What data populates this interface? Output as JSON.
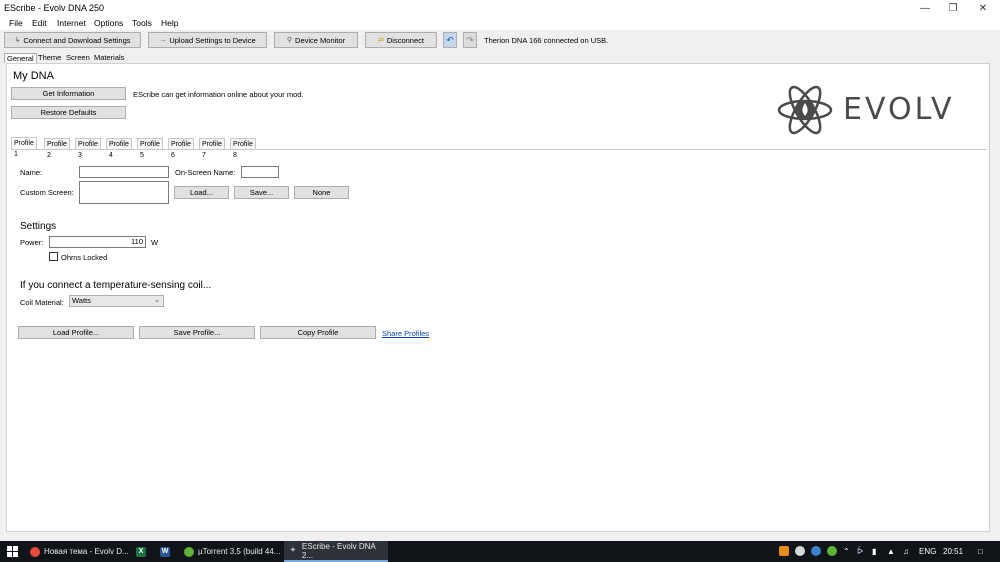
{
  "window": {
    "title": "EScribe - Evolv DNA 250",
    "controls": [
      "minimize-icon",
      "restore-icon",
      "close-icon"
    ]
  },
  "menu": [
    "File",
    "Edit",
    "Internet",
    "Options",
    "Tools",
    "Help"
  ],
  "toolbar": {
    "connect_label": "Connect and Download Settings",
    "upload_label": "Upload Settings to Device",
    "monitor_label": "Device Monitor",
    "disconnect_label": "Disconnect",
    "status_text": "Therion DNA 166 connected on USB."
  },
  "main_tabs": [
    "General",
    "Theme",
    "Screen",
    "Materials"
  ],
  "mydna": {
    "heading": "My DNA",
    "get_info_label": "Get Information",
    "restore_label": "Restore Defaults",
    "info_text": "EScribe can get information online about your mod."
  },
  "logo": {
    "text": "EVOLV",
    "color": "#4a4a4a"
  },
  "profile_tabs": [
    "Profile 1",
    "Profile 2",
    "Profile 3",
    "Profile 4",
    "Profile 5",
    "Profile 6",
    "Profile 7",
    "Profile 8"
  ],
  "profile": {
    "name_label": "Name:",
    "name_value": "",
    "onscreen_label": "On-Screen Name:",
    "onscreen_value": "",
    "custom_screen_label": "Custom Screen:",
    "load_label": "Load...",
    "save_label": "Save...",
    "none_label": "None",
    "settings_heading": "Settings",
    "power_label": "Power:",
    "power_value": "110",
    "power_unit": "W",
    "ohms_locked_label": "Ohms Locked",
    "ohms_locked_checked": false,
    "temp_heading": "If you connect a temperature-sensing coil...",
    "coil_material_label": "Coil Material:",
    "coil_material_value": "Watts",
    "load_profile_label": "Load Profile...",
    "save_profile_label": "Save Profile...",
    "copy_profile_label": "Copy Profile",
    "share_profiles_label": "Share Profiles"
  },
  "taskbar": {
    "items": [
      {
        "label": "Новая тема - Evolv D...",
        "icon": "chrome-icon"
      },
      {
        "label": "",
        "icon": "excel-icon"
      },
      {
        "label": "",
        "icon": "word-icon"
      },
      {
        "label": "µTorrent 3.5  (build 44...",
        "icon": "utorrent-icon"
      },
      {
        "label": "EScribe - Evolv DNA 2...",
        "icon": "escribe-icon"
      }
    ],
    "lang": "ENG",
    "time": "20:51"
  }
}
